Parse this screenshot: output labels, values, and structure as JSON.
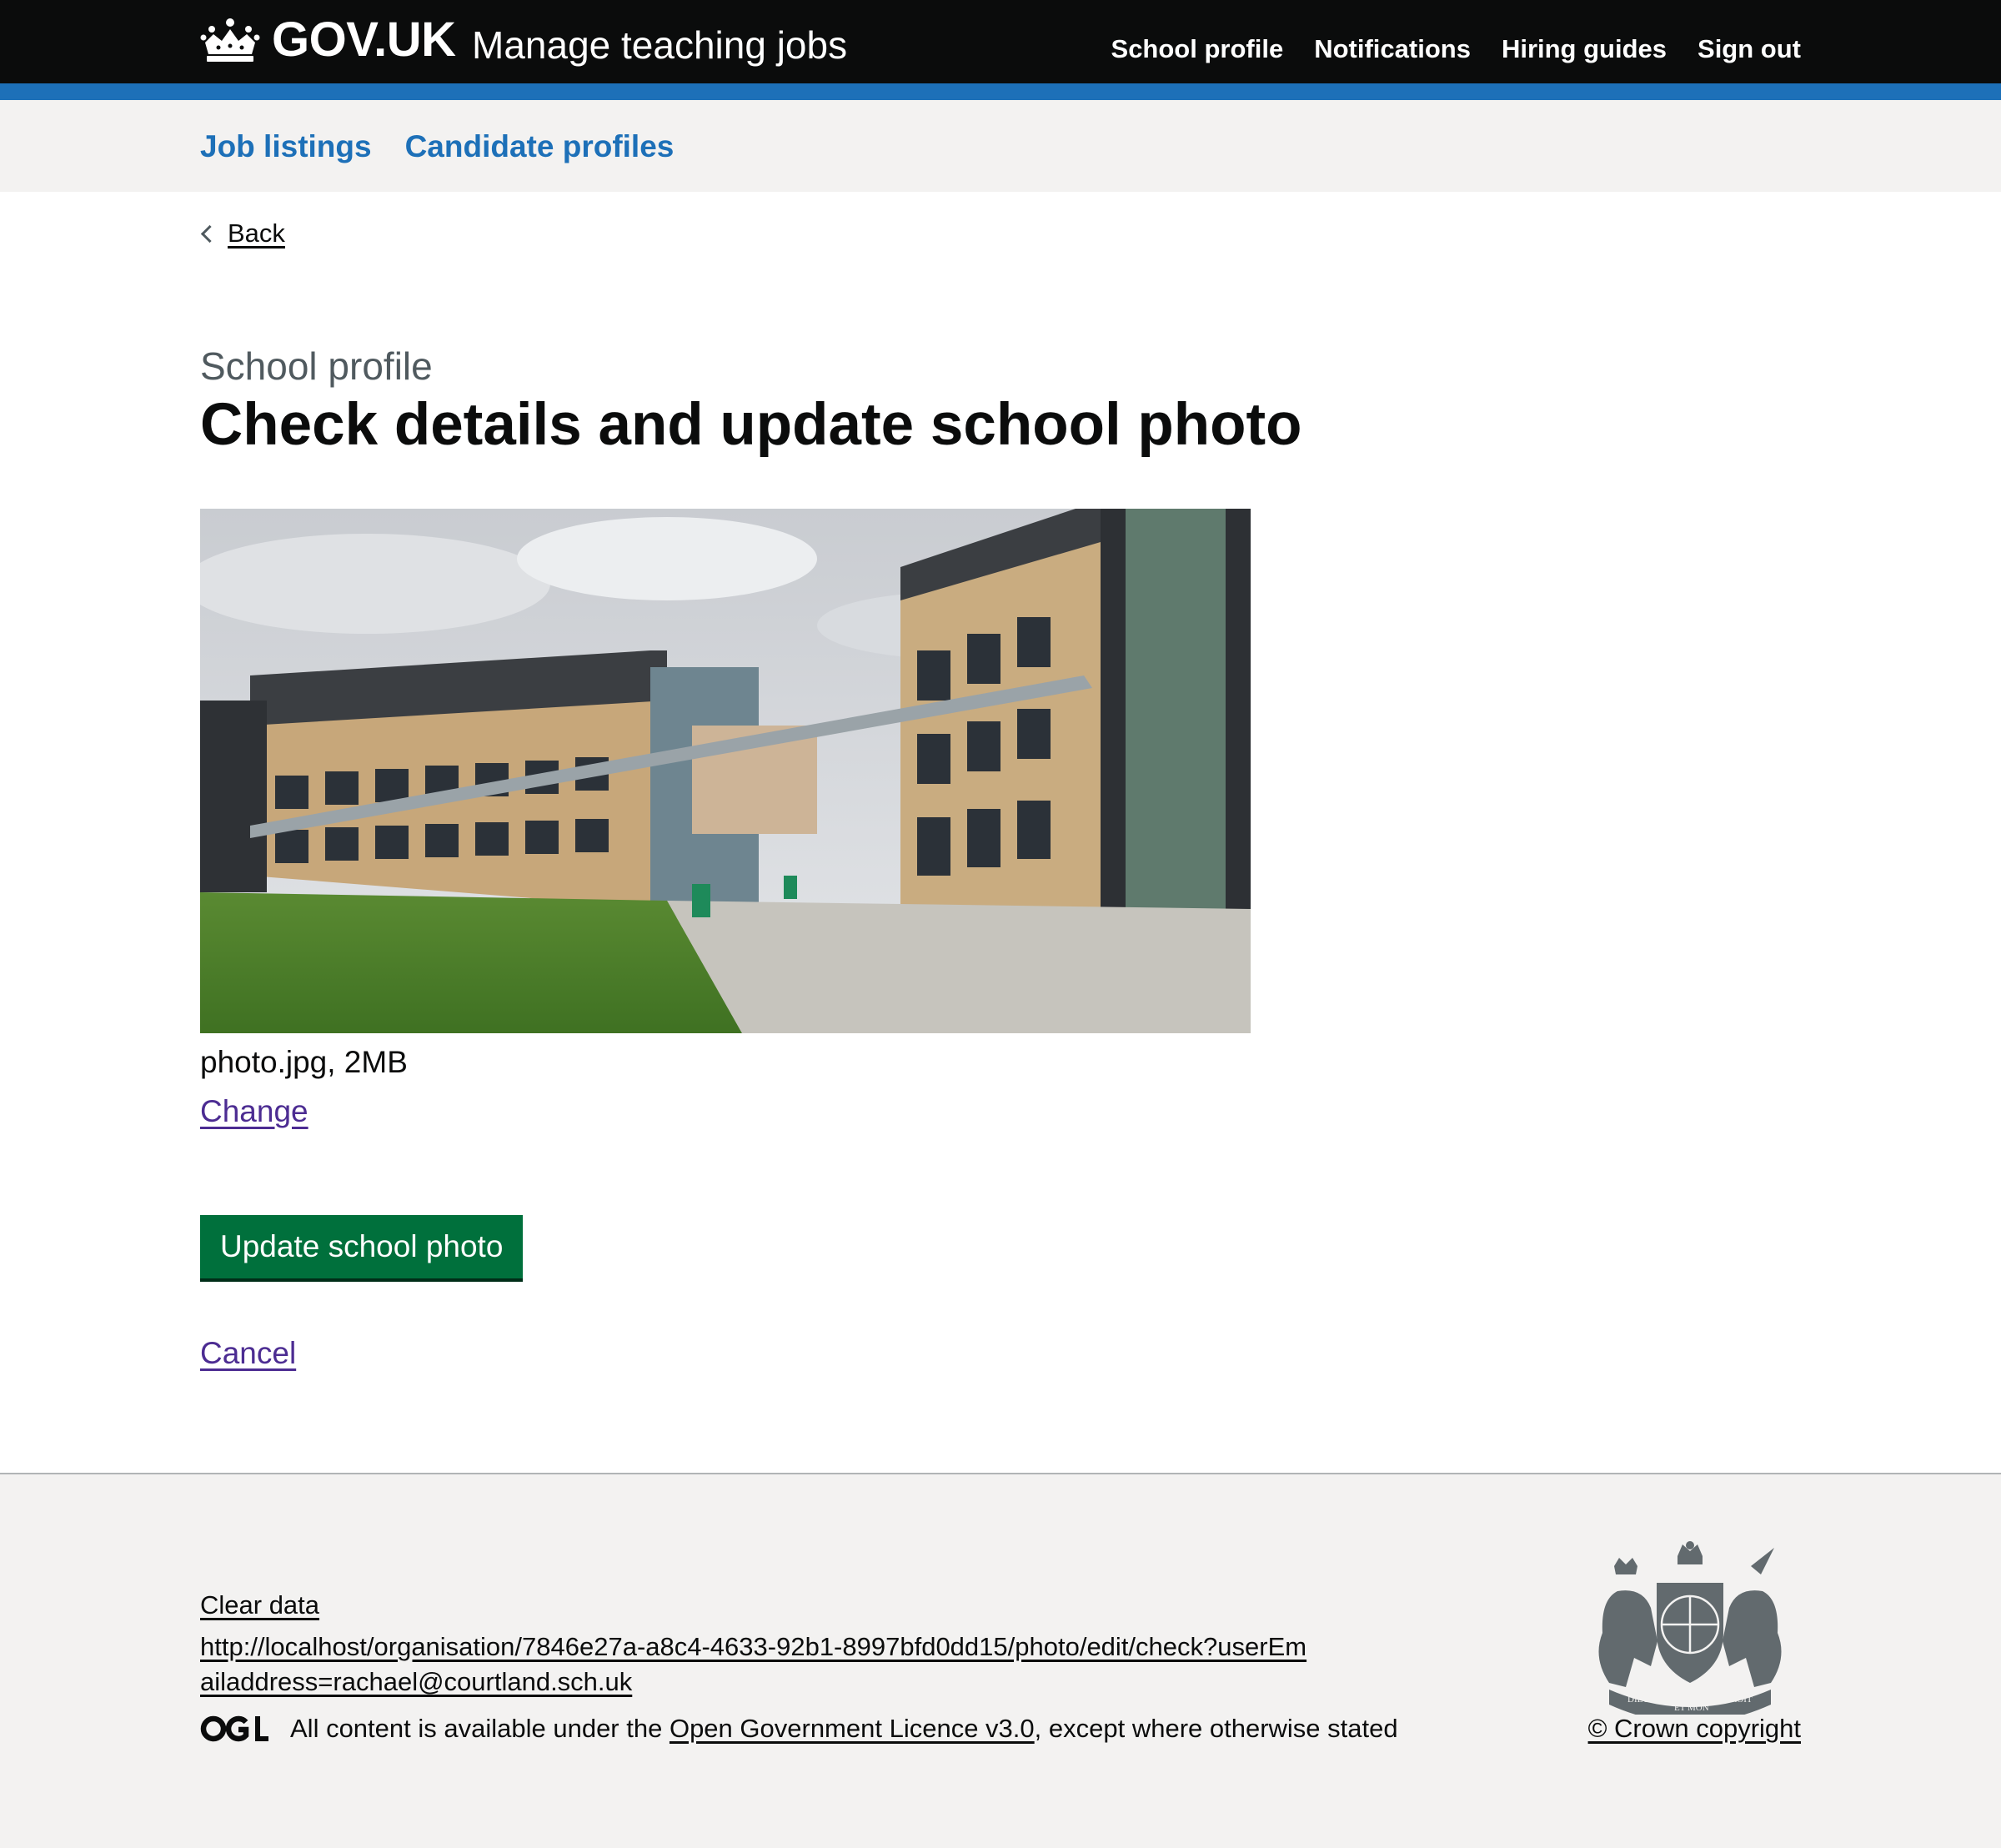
{
  "header": {
    "logo_text": "GOV.UK",
    "service_name": "Manage teaching jobs",
    "nav": [
      {
        "label": "School profile"
      },
      {
        "label": "Notifications"
      },
      {
        "label": "Hiring guides"
      },
      {
        "label": "Sign out"
      }
    ]
  },
  "subnav": {
    "items": [
      {
        "label": "Job listings"
      },
      {
        "label": "Candidate profiles"
      }
    ]
  },
  "main": {
    "back_label": "Back",
    "caption": "School profile",
    "title": "Check details and update school photo",
    "file_info": "photo.jpg, 2MB",
    "change_label": "Change",
    "update_button_label": "Update school photo",
    "cancel_label": "Cancel"
  },
  "footer": {
    "clear_data_label": "Clear data",
    "url_text": "http://localhost/organisation/7846e27a-a8c4-4633-92b1-8997bfd0dd15/photo/edit/check?userEmailaddress=rachael@courtland.sch.uk",
    "licence_prefix": "All content is available under the ",
    "licence_link": "Open Government Licence v3.0",
    "licence_suffix": ", except where otherwise stated",
    "copyright_label": "© Crown copyright",
    "crest_motto": [
      "DIEU",
      "ET MON",
      "DROIT"
    ]
  },
  "colors": {
    "header_bg": "#0b0c0c",
    "brand_blue": "#1d70b8",
    "button_green": "#00703c",
    "visited_link": "#4c2c92",
    "footer_bg": "#f3f2f1"
  }
}
